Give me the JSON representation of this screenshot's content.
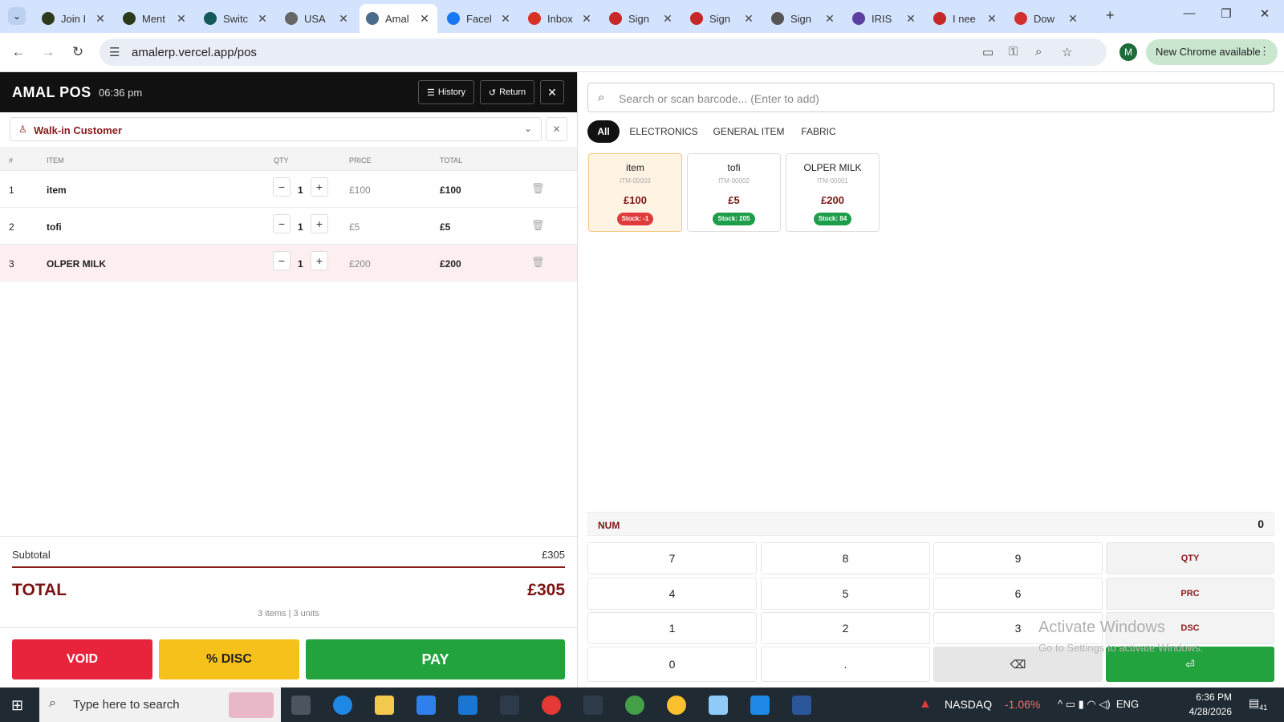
{
  "browser": {
    "tabs": [
      {
        "label": "Join I",
        "color": "#2d3a1a"
      },
      {
        "label": "Ment",
        "color": "#2d3a1a"
      },
      {
        "label": "Switc",
        "color": "#145a5a"
      },
      {
        "label": "USA",
        "color": "#666666"
      },
      {
        "label": "Amal",
        "color": "#4a6b8a",
        "active": true
      },
      {
        "label": "Facel",
        "color": "#1877f2"
      },
      {
        "label": "Inbox",
        "color": "#d93025"
      },
      {
        "label": "Sign",
        "color": "#c62828"
      },
      {
        "label": "Sign",
        "color": "#c62828"
      },
      {
        "label": "Sign",
        "color": "#555555"
      },
      {
        "label": "IRIS",
        "color": "#5b3fa0"
      },
      {
        "label": "I nee",
        "color": "#c62828"
      },
      {
        "label": "Dow",
        "color": "#d32f2f"
      }
    ],
    "new_tab": "+",
    "url": "amalerp.vercel.app/pos",
    "profile_initial": "M",
    "new_chrome": "New Chrome available"
  },
  "pos": {
    "brand": "AMAL POS",
    "time": "06:36 pm",
    "history_label": "History",
    "return_label": "Return",
    "customer": "Walk-in Customer",
    "columns": {
      "num": "#",
      "item": "ITEM",
      "qty": "QTY",
      "price": "PRICE",
      "total": "TOTAL"
    },
    "cart": [
      {
        "num": "1",
        "name": "item",
        "qty": "1",
        "price": "£100",
        "total": "£100"
      },
      {
        "num": "2",
        "name": "tofi",
        "qty": "1",
        "price": "£5",
        "total": "£5"
      },
      {
        "num": "3",
        "name": "OLPER MILK",
        "qty": "1",
        "price": "£200",
        "total": "£200"
      }
    ],
    "subtotal_label": "Subtotal",
    "subtotal": "£305",
    "total_label": "TOTAL",
    "total": "£305",
    "summary": "3 items | 3 units",
    "void_label": "VOID",
    "disc_label": "% DISC",
    "pay_label": "PAY"
  },
  "catalog": {
    "search_placeholder": "Search or scan barcode... (Enter to add)",
    "categories": [
      "All",
      "ELECTRONICS",
      "GENERAL ITEM",
      "FABRIC"
    ],
    "products": [
      {
        "name": "item",
        "code": "ITM-00003",
        "price": "£100",
        "stock": "Stock: -1"
      },
      {
        "name": "tofi",
        "code": "ITM-00002",
        "price": "£5",
        "stock": "Stock: 205"
      },
      {
        "name": "OLPER MILK",
        "code": "ITM-00001",
        "price": "£200",
        "stock": "Stock: 84"
      }
    ]
  },
  "numpad": {
    "label": "NUM",
    "value": "0",
    "keys": [
      "7",
      "8",
      "9",
      "QTY",
      "4",
      "5",
      "6",
      "PRC",
      "1",
      "2",
      "3",
      "DSC",
      "0",
      "."
    ]
  },
  "watermark": {
    "line1": "Activate Windows",
    "line2": "Go to Settings to activate Windows."
  },
  "taskbar": {
    "search_placeholder": "Type here to search",
    "ticker": "NASDAQ",
    "ticker_change": "-1.06%",
    "lang": "ENG",
    "time": "6:36 PM",
    "date": "4/28/2026",
    "notifications": "41"
  },
  "colors": {
    "brand_dark": "#111111",
    "accent_maroon": "#7a1414",
    "void": "#e8243c",
    "disc": "#f7c11b",
    "pay": "#22a33e",
    "stock_negative": "#e03b3b",
    "stock_ok": "#1e9e4a"
  }
}
